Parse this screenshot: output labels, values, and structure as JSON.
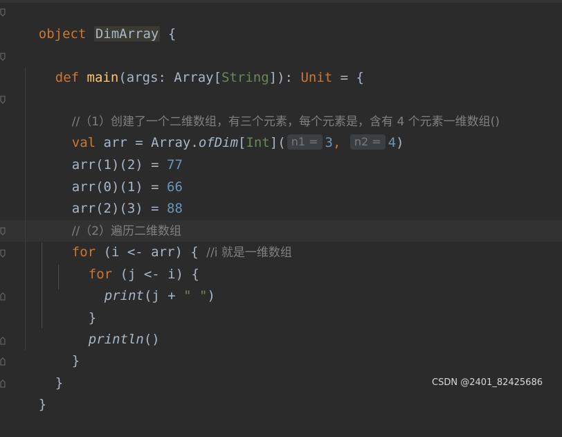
{
  "editor": {
    "object_keyword": "object",
    "object_name": "DimArray",
    "open_brace": " {",
    "def_keyword": "def",
    "main_name": "main",
    "main_sig_1": "(args: Array[",
    "main_sig_type": "String",
    "main_sig_2": "]): ",
    "main_sig_unit": "Unit",
    "main_sig_3": " = {",
    "comment1": "//（1）创建了一个二维数组，有三个元素，每个元素是，含有 4 个元素一维数组()",
    "val_keyword": "val",
    "val_rest_1": " arr = Array.",
    "val_ofdim": "ofDim",
    "val_bracket_open": "[",
    "val_type": "Int",
    "val_bracket_close": "](",
    "hint_n1": "n1 =",
    "val_n1": "3",
    "val_comma": ",",
    "hint_n2": "n2 =",
    "val_n2": "4",
    "val_close": ")",
    "assign1_left": "arr(1)(2) = ",
    "assign1_val": "77",
    "assign2_left": "arr(0)(1) = ",
    "assign2_val": "66",
    "assign3_left": "arr(2)(3) = ",
    "assign3_val": "88",
    "comment2": "//（2）遍历二维数组",
    "for_keyword": "for",
    "for1_rest": " (i <- arr) { ",
    "for1_comment": "//i 就是一维数组",
    "for2_rest": " (j <- i) {",
    "print_fn": "print",
    "print_args_1": "(j + ",
    "print_string": "\" \"",
    "print_args_2": ")",
    "close_brace_inner": "}",
    "println_fn": "println",
    "println_args": "()",
    "close_brace_for": "}",
    "close_brace_main": "}",
    "close_brace_object": "}"
  },
  "watermark": "CSDN @2401_82425686"
}
